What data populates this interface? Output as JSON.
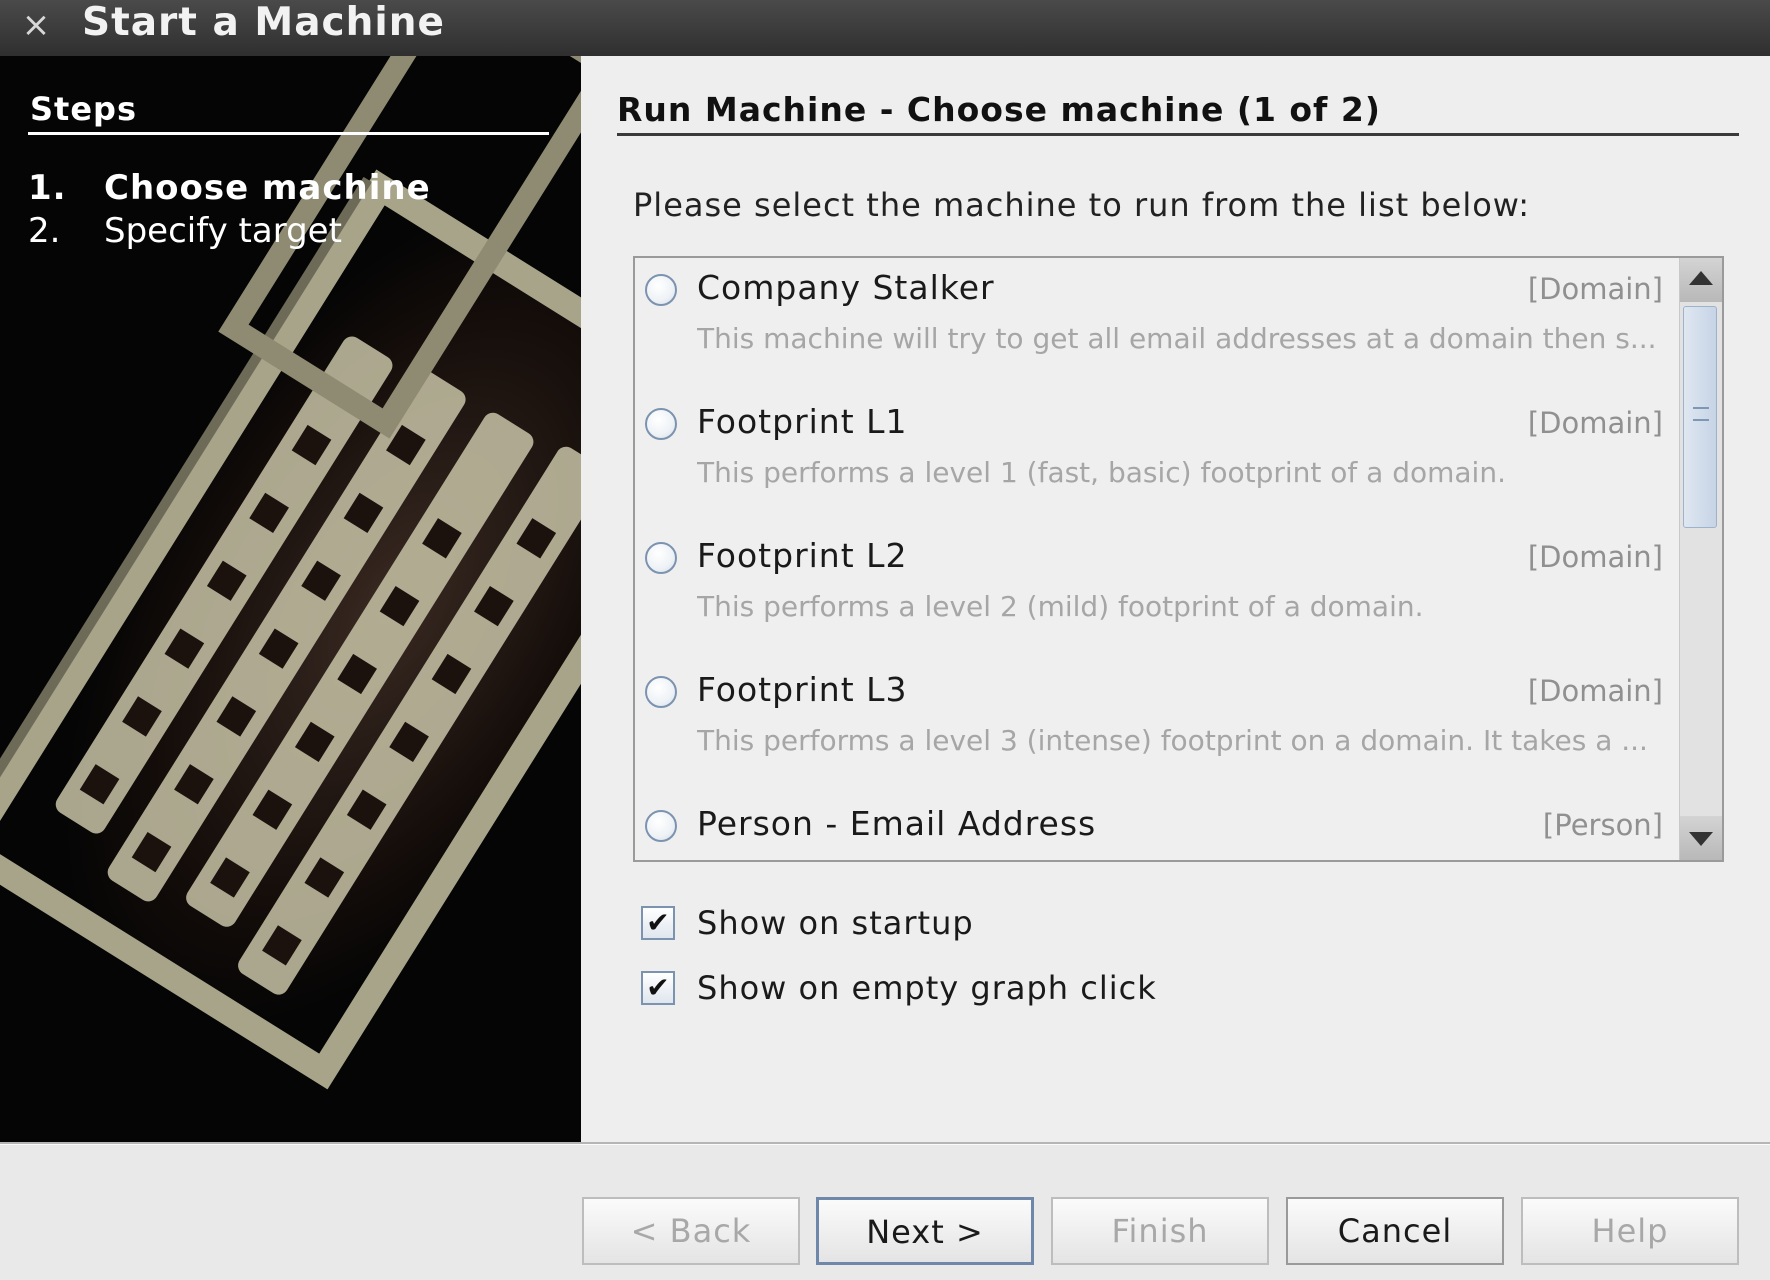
{
  "window": {
    "title": "Start a Machine",
    "close_glyph": "×"
  },
  "sidebar": {
    "heading": "Steps",
    "steps": [
      {
        "number": "1.",
        "label": "Choose machine",
        "active": true
      },
      {
        "number": "2.",
        "label": "Specify target",
        "active": false
      }
    ],
    "artwork_icon": "maltego-radium-community-edition-artwork"
  },
  "main": {
    "heading": "Run Machine - Choose machine (1 of 2)",
    "prompt": "Please select the machine to run from the list below:",
    "machines": [
      {
        "name": "Company Stalker",
        "type": "[Domain]",
        "description": "This machine will try to get all email addresses at a domain then s...",
        "selected": false
      },
      {
        "name": "Footprint L1",
        "type": "[Domain]",
        "description": "This performs a level 1 (fast, basic) footprint of a domain.",
        "selected": false
      },
      {
        "name": "Footprint L2",
        "type": "[Domain]",
        "description": "This performs a level 2 (mild) footprint of a domain.",
        "selected": false
      },
      {
        "name": "Footprint L3",
        "type": "[Domain]",
        "description": "This performs a level 3 (intense) footprint on a domain. It takes a ...",
        "selected": false
      },
      {
        "name": "Person - Email Address",
        "type": "[Person]",
        "description": "",
        "selected": false
      }
    ],
    "options": [
      {
        "label": "Show on startup",
        "checked": true
      },
      {
        "label": "Show on empty graph click",
        "checked": true
      }
    ],
    "check_glyph": "✔"
  },
  "buttons": {
    "back": "< Back",
    "next": "Next >",
    "finish": "Finish",
    "cancel": "Cancel",
    "help": "Help"
  }
}
